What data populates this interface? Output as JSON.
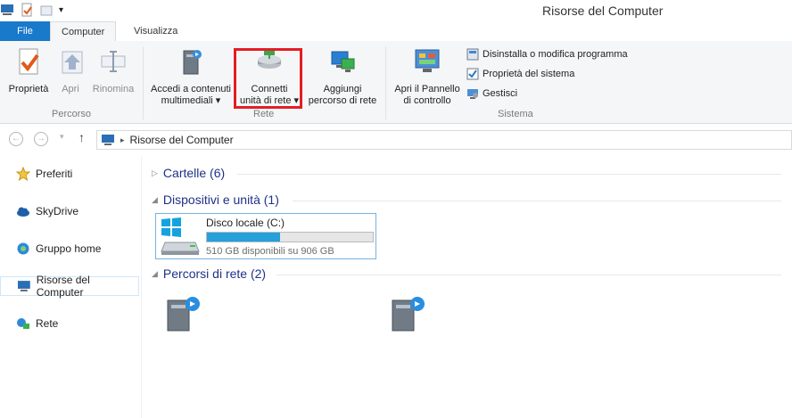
{
  "window": {
    "title": "Risorse del Computer"
  },
  "tabs": {
    "file": "File",
    "computer": "Computer",
    "visualizza": "Visualizza"
  },
  "ribbon": {
    "percorso": {
      "label": "Percorso",
      "proprieta": "Proprietà",
      "apri": "Apri",
      "rinomina": "Rinomina"
    },
    "rete": {
      "label": "Rete",
      "accedi_line1": "Accedi a contenuti",
      "accedi_line2": "multimediali",
      "connetti_line1": "Connetti",
      "connetti_line2": "unità di rete",
      "aggiungi_line1": "Aggiungi",
      "aggiungi_line2": "percorso di rete"
    },
    "sistema": {
      "label": "Sistema",
      "apri_pannello_line1": "Apri il Pannello",
      "apri_pannello_line2": "di controllo",
      "disinstalla": "Disinstalla o modifica programma",
      "proprieta_sistema": "Proprietà del sistema",
      "gestisci": "Gestisci"
    },
    "dropdown_glyph": "▾"
  },
  "address": {
    "path": "Risorse del Computer"
  },
  "sidebar": {
    "items": [
      {
        "label": "Preferiti"
      },
      {
        "label": "SkyDrive"
      },
      {
        "label": "Gruppo home"
      },
      {
        "label": "Risorse del Computer"
      },
      {
        "label": "Rete"
      }
    ]
  },
  "content": {
    "cartelle": "Cartelle (6)",
    "dispositivi": "Dispositivi e unità (1)",
    "percorsi": "Percorsi di rete (2)",
    "drive": {
      "name": "Disco locale (C:)",
      "free_text": "510 GB disponibili su 906 GB",
      "used_fraction": 0.44
    }
  },
  "colors": {
    "accent": "#1979ca",
    "highlight": "#e31e24",
    "drive_bar": "#26a0da"
  }
}
